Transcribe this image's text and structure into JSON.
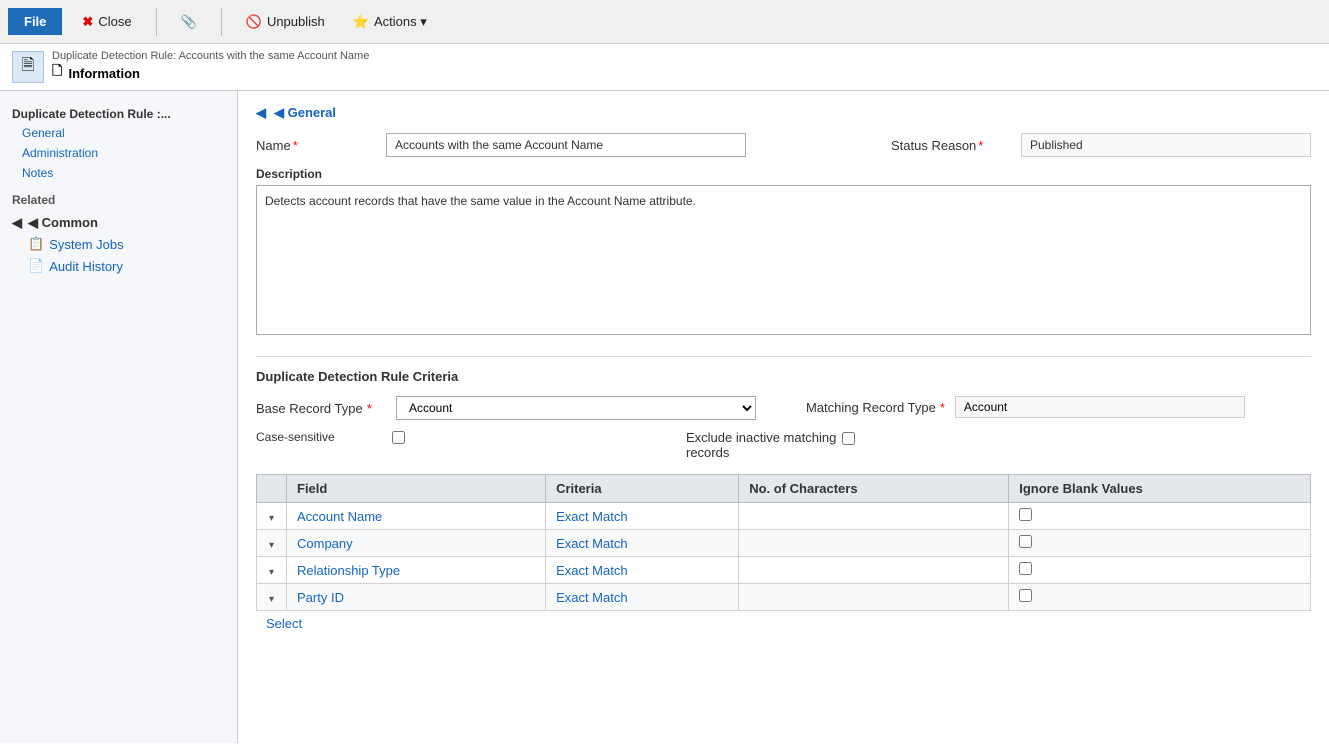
{
  "toolbar": {
    "file_label": "File",
    "close_label": "Close",
    "unpublish_label": "Unpublish",
    "actions_label": "Actions ▾"
  },
  "header": {
    "breadcrumb": "Duplicate Detection Rule: Accounts with the same Account Name",
    "title": "Information",
    "title_icon": "🗋"
  },
  "sidebar": {
    "section_title": "Duplicate Detection Rule :...",
    "items": [
      {
        "label": "General"
      },
      {
        "label": "Administration"
      },
      {
        "label": "Notes"
      }
    ],
    "related_title": "Related",
    "common_title": "◀ Common",
    "common_items": [
      {
        "label": "System Jobs",
        "icon": "📋"
      },
      {
        "label": "Audit History",
        "icon": "📄"
      }
    ]
  },
  "general_section": {
    "title": "◀ General",
    "name_label": "Name",
    "name_value": "Accounts with the same Account Name",
    "status_reason_label": "Status Reason",
    "status_reason_value": "Published",
    "description_label": "Description",
    "description_value": "Detects account records that have the same value in the Account Name attribute."
  },
  "criteria_section": {
    "title": "Duplicate Detection Rule Criteria",
    "base_record_type_label": "Base Record Type",
    "base_record_type_value": "Account",
    "matching_record_type_label": "Matching Record Type",
    "matching_record_type_value": "Account",
    "case_sensitive_label": "Case-sensitive",
    "exclude_inactive_label": "Exclude inactive matching",
    "exclude_inactive_label2": "records",
    "table_headers": [
      "",
      "Field",
      "Criteria",
      "No. of Characters",
      "Ignore Blank Values"
    ],
    "table_rows": [
      {
        "field": "Account Name",
        "criteria": "Exact Match"
      },
      {
        "field": "Company",
        "criteria": "Exact Match"
      },
      {
        "field": "Relationship Type",
        "criteria": "Exact Match"
      },
      {
        "field": "Party ID",
        "criteria": "Exact Match"
      }
    ],
    "select_link": "Select"
  },
  "icons": {
    "close": "✖",
    "clip": "📎",
    "unpublish": "🚫",
    "triangle": "▶",
    "chevron_down": "▾",
    "chevron_left": "◀"
  }
}
